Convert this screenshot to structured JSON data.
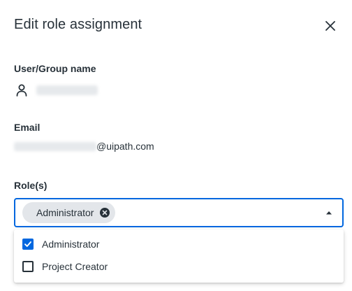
{
  "dialog": {
    "title": "Edit role assignment",
    "close_icon": "close-icon"
  },
  "user_group": {
    "label": "User/Group name",
    "icon": "person-icon"
  },
  "email": {
    "label": "Email",
    "domain_text": "@uipath.com"
  },
  "roles": {
    "label": "Role(s)",
    "selected_chips": [
      {
        "label": "Administrator",
        "remove_icon": "cancel-circle-icon"
      }
    ],
    "options": [
      {
        "label": "Administrator",
        "checked": true
      },
      {
        "label": "Project Creator",
        "checked": false
      }
    ]
  },
  "colors": {
    "accent": "#0067df",
    "text": "#273139",
    "chip_bg": "#e3e6ea"
  }
}
